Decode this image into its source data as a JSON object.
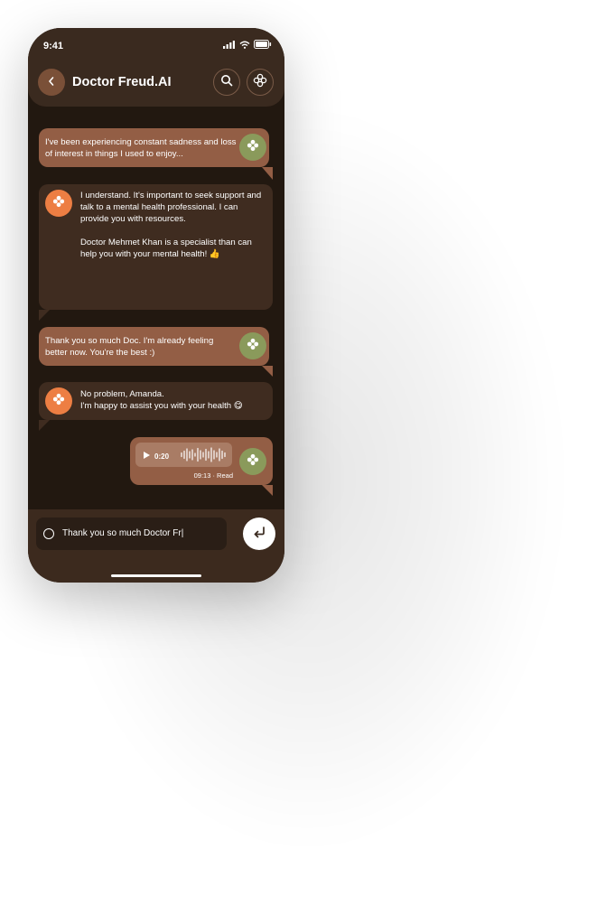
{
  "status": {
    "time": "9:41"
  },
  "header": {
    "title": "Doctor Freud.AI",
    "back_icon": "chevron-left-icon",
    "search_icon": "search-icon",
    "menu_icon": "flower-icon"
  },
  "messages": [
    {
      "from": "user",
      "text": "I've been experiencing constant sadness and loss of interest in things I used to enjoy..."
    },
    {
      "from": "bot",
      "p1": "I understand. It's important to seek support and talk to a mental health professional. I can provide you with resources.",
      "p2": "Doctor Mehmet Khan is a specialist than can help you with your mental health! 👍"
    },
    {
      "from": "user",
      "text": "Thank you so much Doc. I'm already feeling better now. You're the best :)"
    },
    {
      "from": "bot",
      "l1": "No problem, Amanda.",
      "l2": "I'm happy to assist you with your health 😋"
    },
    {
      "from": "user",
      "type": "voice",
      "duration": "0:20",
      "meta": "09:13 · Read"
    }
  ],
  "composer": {
    "value": "Thank you so much Doctor Fr|"
  },
  "colors": {
    "accent_user": "#935e45",
    "accent_bot": "#3f2c20",
    "avatar_green": "#8a9a5b",
    "avatar_orange": "#ed7e43"
  }
}
